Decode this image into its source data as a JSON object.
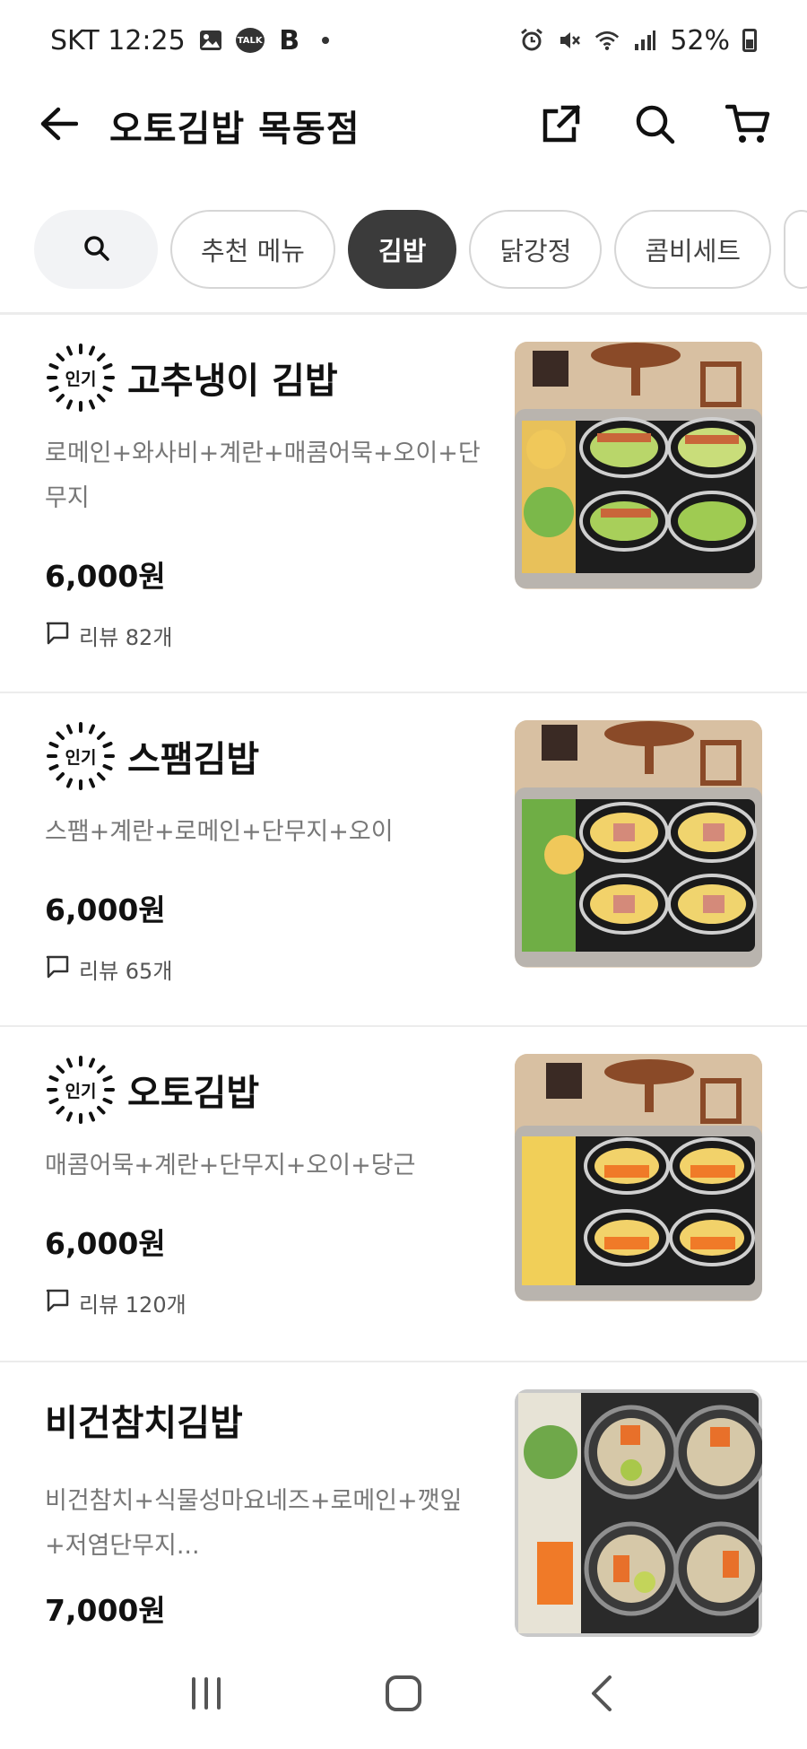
{
  "status_bar": {
    "carrier_time": "SKT 12:25",
    "talk_label": "TALK",
    "b_label": "B",
    "battery": "52%"
  },
  "header": {
    "title": "오토김밥 목동점"
  },
  "tabs": [
    {
      "label": "추천 메뉴",
      "active": false
    },
    {
      "label": "김밥",
      "active": true
    },
    {
      "label": "닭강정",
      "active": false
    },
    {
      "label": "콤비세트",
      "active": false
    }
  ],
  "menu": [
    {
      "badge": "인기",
      "name": "고추냉이 김밥",
      "desc": "로메인+와사비+계란+매콤어묵+오이+단무지",
      "price": "6,000원",
      "review": "리뷰 82개"
    },
    {
      "badge": "인기",
      "name": "스팸김밥",
      "desc": "스팸+계란+로메인+단무지+오이",
      "price": "6,000원",
      "review": "리뷰 65개"
    },
    {
      "badge": "인기",
      "name": "오토김밥",
      "desc": "매콤어묵+계란+단무지+오이+당근",
      "price": "6,000원",
      "review": "리뷰 120개"
    },
    {
      "badge": "",
      "name": "비건참치김밥",
      "desc": "비건참치+식물성마요네즈+로메인+깻잎+저염단무지...",
      "price": "7,000원",
      "review": ""
    }
  ],
  "icons": {
    "back": "arrow-left-icon",
    "share": "share-icon",
    "search": "search-icon",
    "cart": "cart-icon"
  },
  "colors": {
    "active_tab_bg": "#3b3b3b",
    "desc_text": "#777777"
  }
}
